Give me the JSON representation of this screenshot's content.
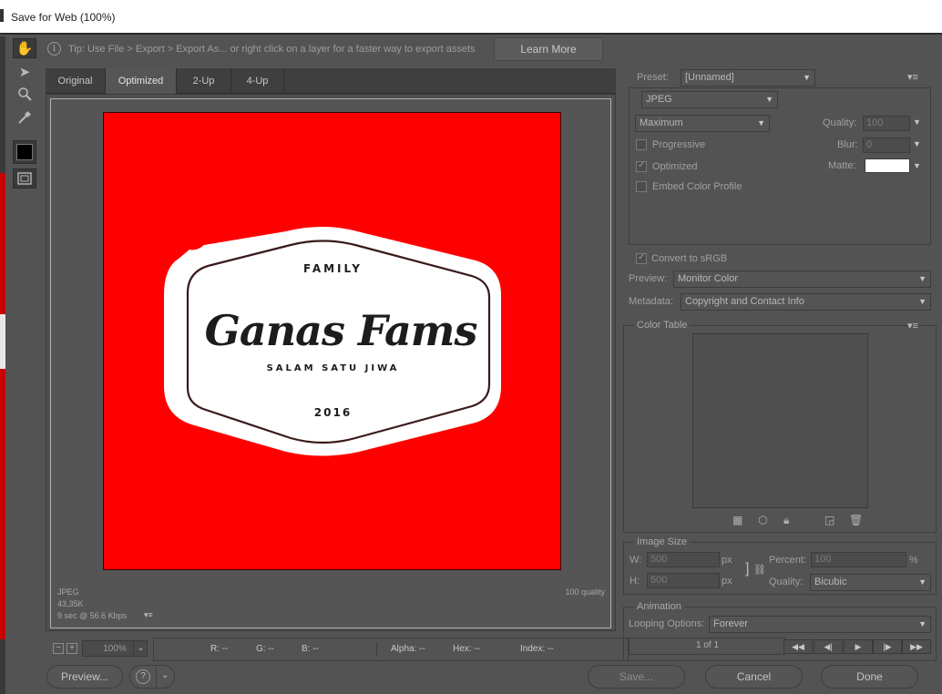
{
  "window": {
    "title": "Save for Web (100%)"
  },
  "tools": [
    {
      "icon": "hand-icon"
    },
    {
      "icon": "slice-select-icon"
    },
    {
      "icon": "zoom-icon"
    },
    {
      "icon": "eyedropper-icon"
    },
    {
      "icon": "eyedropper-color-swatch",
      "color": "#000000"
    },
    {
      "icon": "toggle-slices-icon"
    }
  ],
  "tip": {
    "text": "Tip: Use File > Export > Export As...  or right click on a layer for a faster way to export assets",
    "learn_more": "Learn More"
  },
  "tabs": [
    {
      "label": "Original",
      "active": false
    },
    {
      "label": "Optimized",
      "active": true
    },
    {
      "label": "2-Up",
      "active": false
    },
    {
      "label": "4-Up",
      "active": false
    }
  ],
  "artwork": {
    "background": "#ff0000",
    "family": "FAMILY",
    "name": "Ganas Fams",
    "tagline": "SALAM SATU JIWA",
    "year": "2016"
  },
  "status": {
    "format": "JPEG",
    "size": "43,35K",
    "time": "9 sec @ 56.6 Kbps",
    "quality": "100 quality"
  },
  "zoom": {
    "value": "100%"
  },
  "pixel_info": {
    "r": "R: --",
    "g": "G: --",
    "b": "B: --",
    "alpha": "Alpha: --",
    "hex": "Hex: --",
    "index": "Index: --"
  },
  "buttons": {
    "preview": "Preview...",
    "save": "Save...",
    "cancel": "Cancel",
    "done": "Done"
  },
  "preset": {
    "label": "Preset:",
    "value": "[Unnamed]",
    "format": "JPEG",
    "quality_level": "Maximum",
    "quality_label": "Quality:",
    "quality_value": "100",
    "blur_label": "Blur:",
    "blur_value": "0",
    "matte_label": "Matte:",
    "matte_color": "#ffffff",
    "progressive": "Progressive",
    "optimized": "Optimized",
    "embed": "Embed Color Profile",
    "convert": "Convert to sRGB",
    "preview_label": "Preview:",
    "preview_value": "Monitor Color",
    "metadata_label": "Metadata:",
    "metadata_value": "Copyright and Contact Info"
  },
  "color_table": {
    "title": "Color Table"
  },
  "image_size": {
    "title": "Image Size",
    "w_label": "W:",
    "w_value": "500",
    "h_label": "H:",
    "h_value": "500",
    "unit": "px",
    "percent_label": "Percent:",
    "percent_value": "100",
    "percent_unit": "%",
    "quality_label": "Quality:",
    "quality_value": "Bicubic"
  },
  "animation": {
    "title": "Animation",
    "looping_label": "Looping Options:",
    "looping_value": "Forever",
    "frame": "1 of 1"
  }
}
